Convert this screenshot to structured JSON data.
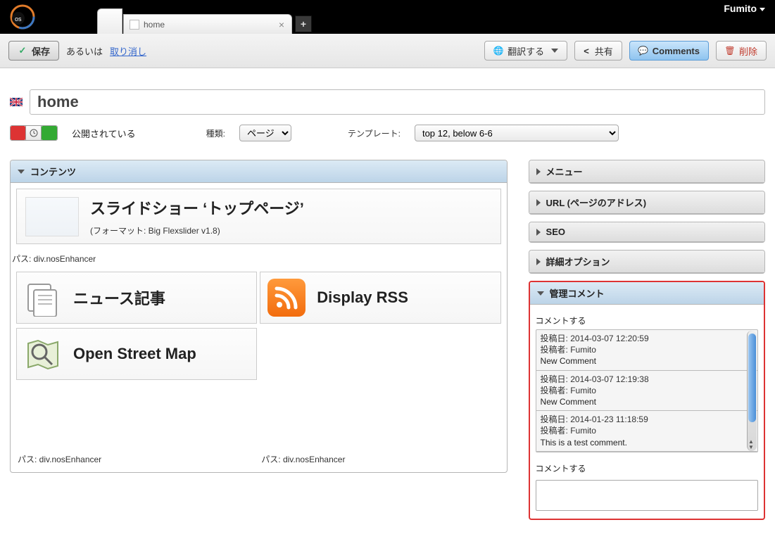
{
  "header": {
    "username": "Fumito",
    "tab_title": "home"
  },
  "toolbar": {
    "save": "保存",
    "or_text": "あるいは",
    "cancel": "取り消し",
    "translate": "翻訳する",
    "share": "共有",
    "comments": "Comments",
    "delete": "削除"
  },
  "title": {
    "value": "home"
  },
  "meta": {
    "published_label": "公開されている",
    "type_label": "種類:",
    "type_value": "ページ",
    "template_label": "テンプレート:",
    "template_value": "top 12, below 6-6"
  },
  "content_panel": {
    "heading": "コンテンツ",
    "block1": {
      "title": "スライドショー ‘トップページ’",
      "subtitle": "(フォーマット: Big Flexslider v1.8)"
    },
    "path1": "パス: div.nosEnhancer",
    "block_news": "ニュース記事",
    "block_rss": "Display RSS",
    "block_osm": "Open Street Map",
    "path2": "パス: div.nosEnhancer",
    "path3": "パス: div.nosEnhancer"
  },
  "side": {
    "menu": "メニュー",
    "url": "URL (ページのアドレス)",
    "seo": "SEO",
    "advanced": "詳細オプション",
    "admin_comments": "管理コメント",
    "comment_do": "コメントする",
    "comments": [
      {
        "date": "投稿日: 2014-03-07 12:20:59",
        "author": "投稿者: Fumito",
        "body": "New Comment"
      },
      {
        "date": "投稿日: 2014-03-07 12:19:38",
        "author": "投稿者: Fumito",
        "body": "New Comment"
      },
      {
        "date": "投稿日: 2014-01-23 11:18:59",
        "author": "投稿者: Fumito",
        "body": "This is a test comment."
      }
    ],
    "comment_do2": "コメントする"
  }
}
